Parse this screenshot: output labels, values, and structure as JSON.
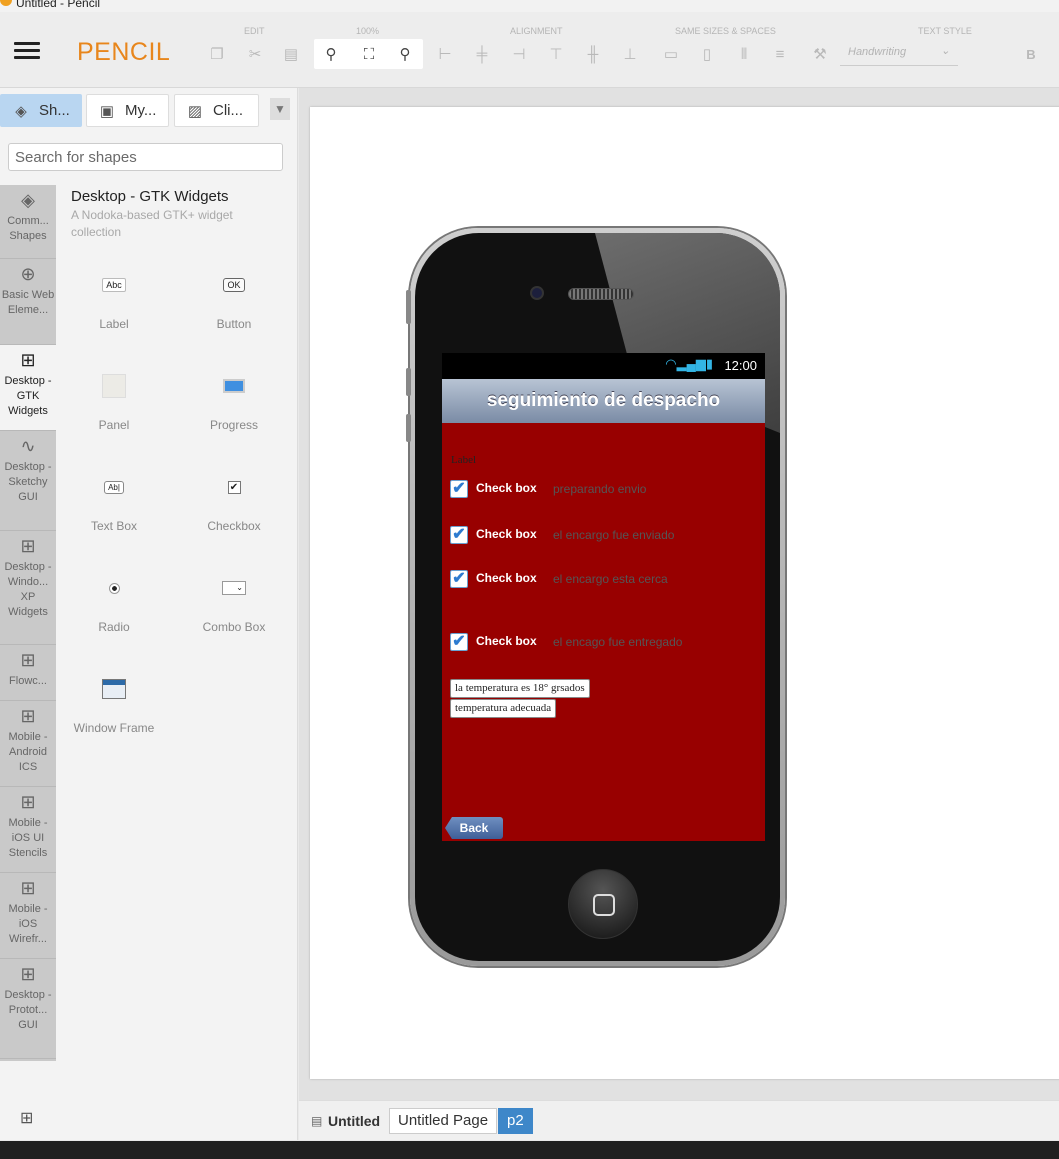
{
  "window": {
    "title": "Untitled - Pencil"
  },
  "toolbar": {
    "brand": "PENCIL",
    "groups": {
      "edit": "EDIT",
      "zoom": "100%",
      "alignment": "ALIGNMENT",
      "same_sizes": "SAME SIZES & SPACES",
      "text_style": "TEXT STYLE"
    },
    "font_family": "Handwriting",
    "bold": "B"
  },
  "sidebar": {
    "tabs": [
      {
        "label": "Sh...",
        "icon": "layers-icon"
      },
      {
        "label": "My...",
        "icon": "briefcase-icon"
      },
      {
        "label": "Cli...",
        "icon": "image-icon"
      }
    ],
    "search_placeholder": "Search for shapes",
    "collections": [
      {
        "label": "Comm... Shapes",
        "icon": "layers-icon"
      },
      {
        "label": "Basic Web Eleme...",
        "icon": "globe-icon"
      },
      {
        "label": "Desktop - GTK Widgets",
        "icon": "grid-icon"
      },
      {
        "label": "Desktop - Sketchy GUI",
        "icon": "squiggle-icon"
      },
      {
        "label": "Desktop - Windo... XP Widgets",
        "icon": "grid-icon"
      },
      {
        "label": "Flowc...",
        "icon": "grid-icon"
      },
      {
        "label": "Mobile - Android ICS",
        "icon": "grid-icon"
      },
      {
        "label": "Mobile - iOS UI Stencils",
        "icon": "grid-icon"
      },
      {
        "label": "Mobile - iOS Wirefr...",
        "icon": "grid-icon"
      },
      {
        "label": "Desktop - Protot... GUI",
        "icon": "grid-icon"
      }
    ],
    "collection_title": "Desktop - GTK Widgets",
    "collection_desc": "A Nodoka-based GTK+ widget collection",
    "shapes": [
      {
        "label": "Label",
        "preview": "Abc"
      },
      {
        "label": "Button",
        "preview": "OK"
      },
      {
        "label": "Panel",
        "preview": ""
      },
      {
        "label": "Progress",
        "preview": ""
      },
      {
        "label": "Text Box",
        "preview": "Ab|"
      },
      {
        "label": "Checkbox",
        "preview": "✔"
      },
      {
        "label": "Radio",
        "preview": ""
      },
      {
        "label": "Combo Box",
        "preview": ""
      },
      {
        "label": "Window Frame",
        "preview": ""
      }
    ]
  },
  "app": {
    "status_time": "12:00",
    "title": "seguimiento de despacho",
    "label": "Label",
    "checkboxes": [
      {
        "label": "Check box",
        "text": "preparando envio",
        "checked": true
      },
      {
        "label": "Check box",
        "text": "el encargo fue enviado",
        "checked": true
      },
      {
        "label": "Check box",
        "text": "el encargo esta cerca",
        "checked": true
      },
      {
        "label": "Check box",
        "text": "el encago fue entregado",
        "checked": true
      }
    ],
    "textbox1": "la temperatura es 18° grsados",
    "textbox2": "temperatura  adecuada",
    "back": "Back"
  },
  "page_tabs": {
    "document": "Untitled",
    "pages": [
      {
        "label": "Untitled Page",
        "active": false
      },
      {
        "label": "p2",
        "active": true
      }
    ]
  },
  "colors": {
    "brand": "#e8861c",
    "screen_bg": "#980000",
    "active_tab": "#b9d6f1",
    "active_page": "#3e87c9"
  }
}
